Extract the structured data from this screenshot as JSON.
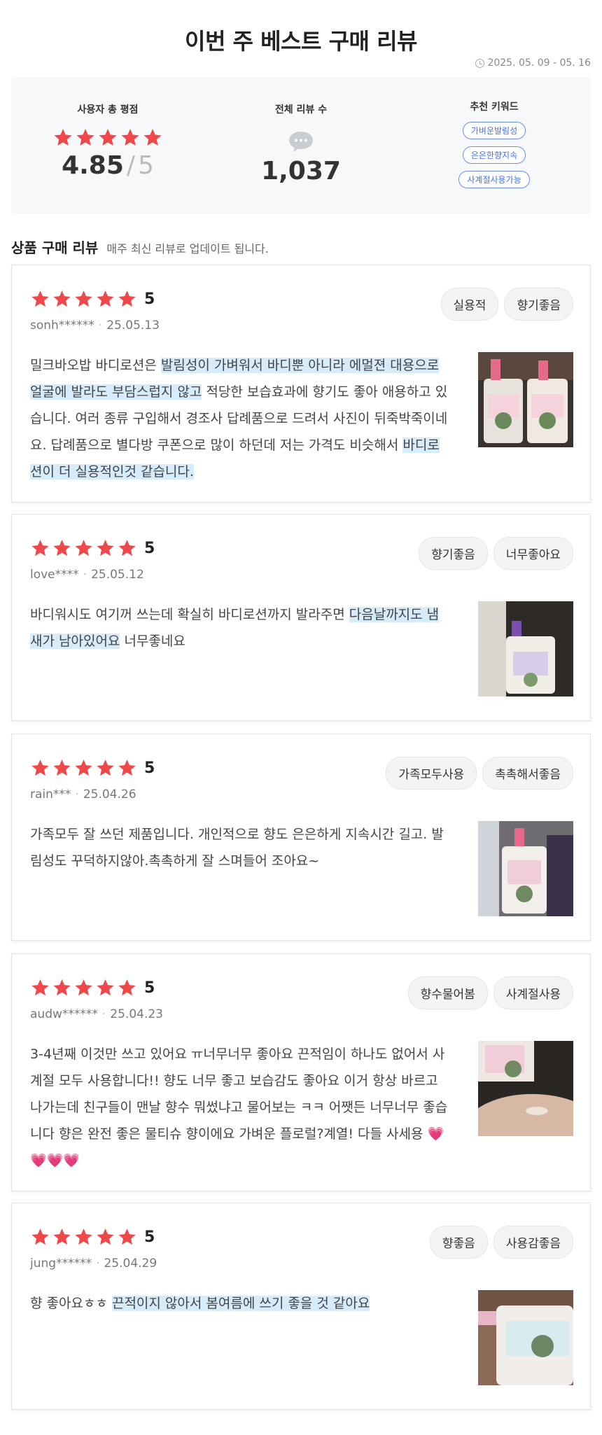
{
  "header": {
    "title": "이번 주 베스트 구매 리뷰",
    "period": "2025. 05. 09 - 05. 16"
  },
  "summary": {
    "rating_label": "사용자 총 평점",
    "rating_value": "4.85",
    "rating_max": "5",
    "rating_slash": "/",
    "count_label": "전체 리뷰 수",
    "count_value": "1,037",
    "keyword_label": "추천 키워드",
    "keywords": [
      "가벼운발림성",
      "은은한향지속",
      "사계절사용가능"
    ]
  },
  "section": {
    "title": "상품 구매 리뷰",
    "subtitle": "매주 최신 리뷰로 업데이트 됩니다."
  },
  "reviews": [
    {
      "score": "5",
      "user": "sonh******",
      "date": "25.05.13",
      "tags": [
        "실용적",
        "향기좋음"
      ],
      "text": [
        {
          "t": "밀크바오밥 바디로션은 "
        },
        {
          "t": "발림성이 가벼워서 바디뿐 아니라 에멀젼 대용으로 얼굴에 발라도 부담스럽지 않고",
          "hl": true
        },
        {
          "t": " 적당한 보습효과에 향기도 좋아 애용하고 있습니다. 여러 종류 구입해서 경조사 답례품으로 드려서 사진이 뒤죽박죽이네요. 답례품으로 별다방 쿠폰으로 많이 하던데 저는 가격도 비슷해서 "
        },
        {
          "t": "바디로션이 더 실용적인것 같습니다.",
          "hl": true
        }
      ]
    },
    {
      "score": "5",
      "user": "love****",
      "date": "25.05.12",
      "tags": [
        "향기좋음",
        "너무좋아요"
      ],
      "text": [
        {
          "t": "바디워시도 여기꺼 쓰는데 확실히 바디로션까지 발라주면 "
        },
        {
          "t": "다음날까지도 냄새가 남아있어요",
          "hl": true
        },
        {
          "t": " 너무좋네요"
        }
      ]
    },
    {
      "score": "5",
      "user": "rain***",
      "date": "25.04.26",
      "tags": [
        "가족모두사용",
        "촉촉해서좋음"
      ],
      "text": [
        {
          "t": "가족모두 잘 쓰던 제품입니다. 개인적으로 향도 은은하게 지속시간 길고. 발림성도 꾸덕하지않아.촉촉하게 잘 스며들어 조아요~"
        }
      ]
    },
    {
      "score": "5",
      "user": "audw******",
      "date": "25.04.23",
      "tags": [
        "향수물어봄",
        "사계절사용"
      ],
      "text": [
        {
          "t": "3-4년째 이것만 쓰고 있어요 ㅠ너무너무 좋아요 끈적임이 하나도 없어서 사계절 모두 사용합니다!! 향도 너무 좋고 보습감도 좋아요 이거 항상 바르고 나가는데 친구들이 맨날 향수 뭐썼냐고 물어보는 ㅋㅋ 어쨋든 너무너무 좋습니다 향은 완전 좋은 물티슈 향이에요 가벼운 플로럴?계열! 다들 사세용 💗💗💗💗"
        }
      ]
    },
    {
      "score": "5",
      "user": "jung******",
      "date": "25.04.29",
      "tags": [
        "향좋음",
        "사용감좋음"
      ],
      "text": [
        {
          "t": "향 좋아요ㅎㅎ "
        },
        {
          "t": "끈적이지 않아서 봄여름에 쓰기 좋을 것 같아요",
          "hl": true
        }
      ]
    }
  ],
  "icons": {
    "star": "star-icon",
    "clock": "clock-icon",
    "comment": "speech-bubble-icon"
  },
  "colors": {
    "star": "#f0474a",
    "highlight": "#d7ecfb",
    "keyword": "#4a70e6"
  }
}
